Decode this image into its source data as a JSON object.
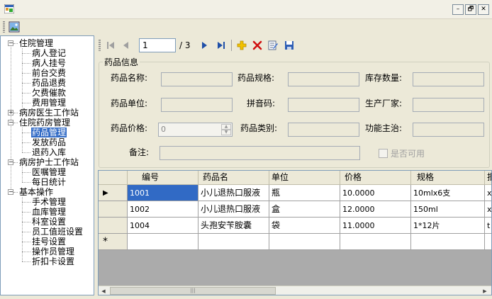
{
  "toolbar1": {
    "button_icon": "image-icon"
  },
  "window_buttons": [
    "–",
    "🗗",
    "✕"
  ],
  "tree": {
    "groups": [
      {
        "label": "住院管理",
        "expanded": true,
        "children": [
          "病人登记",
          "病人挂号",
          "前台交费",
          "药品退费",
          "欠费催款",
          "费用管理"
        ]
      },
      {
        "label": "病房医生工作站",
        "expanded": false,
        "children": []
      },
      {
        "label": "住院药房管理",
        "expanded": true,
        "children": [
          "药品管理",
          "发放药品",
          "退药入库"
        ]
      },
      {
        "label": "病房护士工作站",
        "expanded": true,
        "children": [
          "医嘱管理",
          "每日统计"
        ]
      },
      {
        "label": "基本操作",
        "expanded": true,
        "children": [
          "手术管理",
          "血库管理",
          "科室设置",
          "员工值班设置",
          "挂号设置",
          "操作员管理",
          "折扣卡设置"
        ]
      }
    ],
    "selected": "药品管理"
  },
  "navigator": {
    "current_page": "1",
    "total_pages": "/ 3",
    "first_icon": "first-page-icon",
    "prev_icon": "prev-page-icon",
    "next_icon": "next-page-icon",
    "last_icon": "last-page-icon",
    "add_icon": "add-icon",
    "delete_icon": "delete-icon",
    "edit_icon": "edit-icon",
    "save_icon": "save-icon"
  },
  "form": {
    "group_title": "药品信息",
    "name_label": "药品名称:",
    "spec_label": "药品规格:",
    "stock_label": "库存数量:",
    "unit_label": "药品单位:",
    "pinyin_label": "拼音码:",
    "maker_label": "生产厂家:",
    "price_label": "药品价格:",
    "price_value": "0",
    "category_label": "药品类别:",
    "function_label": "功能主治:",
    "remark_label": "备注:",
    "available_label": "是否可用"
  },
  "grid": {
    "columns": [
      "编号",
      "药品名",
      "单位",
      "价格",
      "规格",
      "批"
    ],
    "rows": [
      [
        "1001",
        "小儿退热口服液",
        "瓶",
        "10.0000",
        "10mlx6支",
        "x-"
      ],
      [
        "1002",
        "小儿退热口服液",
        "盒",
        "12.0000",
        "150ml",
        "x-"
      ],
      [
        "1004",
        "头孢安苄胺囊",
        "袋",
        "11.0000",
        "1*12片",
        "t"
      ]
    ],
    "current_row_marker": "▶",
    "new_row_marker": "*"
  }
}
